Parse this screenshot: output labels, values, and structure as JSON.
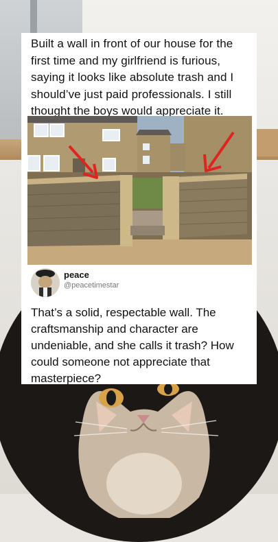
{
  "post": {
    "text": "Built a wall in front of our house for the first time and my girlfriend is furious, saying it looks like absolute trash and I should’ve just paid professionals. I still thought the boys would appreciate it."
  },
  "reply": {
    "username": "peace",
    "handle": "@peacetimestar",
    "text": "That’s a solid, respectable wall. The craftsmanship and character are undeniable, and she calls it trash? How could someone not appreciate that masterpiece?"
  },
  "icons": {
    "arrow_left": "red-arrow-icon",
    "arrow_right": "red-arrow-icon"
  },
  "colors": {
    "arrow": "#e0231e",
    "card_background": "#ffffff",
    "handle_text": "#777777"
  }
}
